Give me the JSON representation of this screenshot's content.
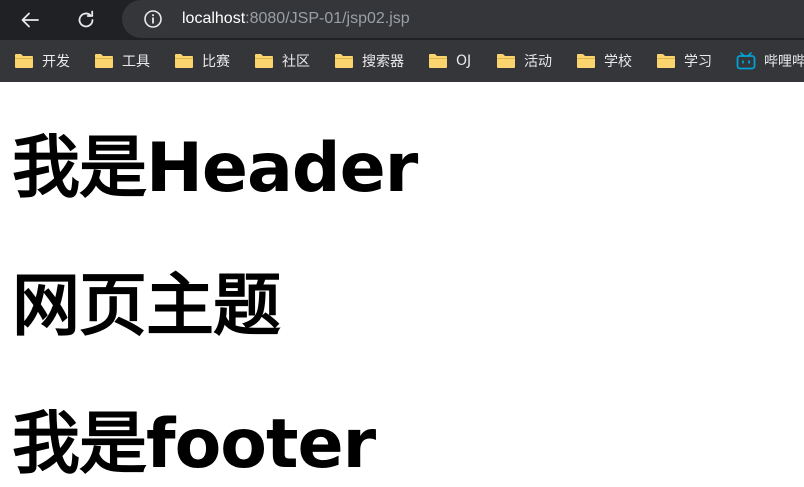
{
  "browser": {
    "url_host": "localhost",
    "url_path": ":8080/JSP-01/jsp02.jsp",
    "icons": {
      "back": "arrow-left-icon",
      "reload": "reload-icon",
      "site_info": "info-icon"
    }
  },
  "bookmarks": [
    {
      "label": "开发",
      "icon": "folder-icon"
    },
    {
      "label": "工具",
      "icon": "folder-icon"
    },
    {
      "label": "比赛",
      "icon": "folder-icon"
    },
    {
      "label": "社区",
      "icon": "folder-icon"
    },
    {
      "label": "搜索器",
      "icon": "folder-icon"
    },
    {
      "label": "OJ",
      "icon": "folder-icon"
    },
    {
      "label": "活动",
      "icon": "folder-icon"
    },
    {
      "label": "学校",
      "icon": "folder-icon"
    },
    {
      "label": "学习",
      "icon": "folder-icon"
    },
    {
      "label": "哔哩哔哩",
      "icon": "bilibili-icon"
    }
  ],
  "page": {
    "header": "我是Header",
    "main": "网页主题",
    "footer": "我是footer"
  },
  "colors": {
    "toolbar_bg": "#202124",
    "omnibox_bg": "#35363a",
    "folder": "#f9d46f",
    "bilibili": "#00a1d6"
  }
}
